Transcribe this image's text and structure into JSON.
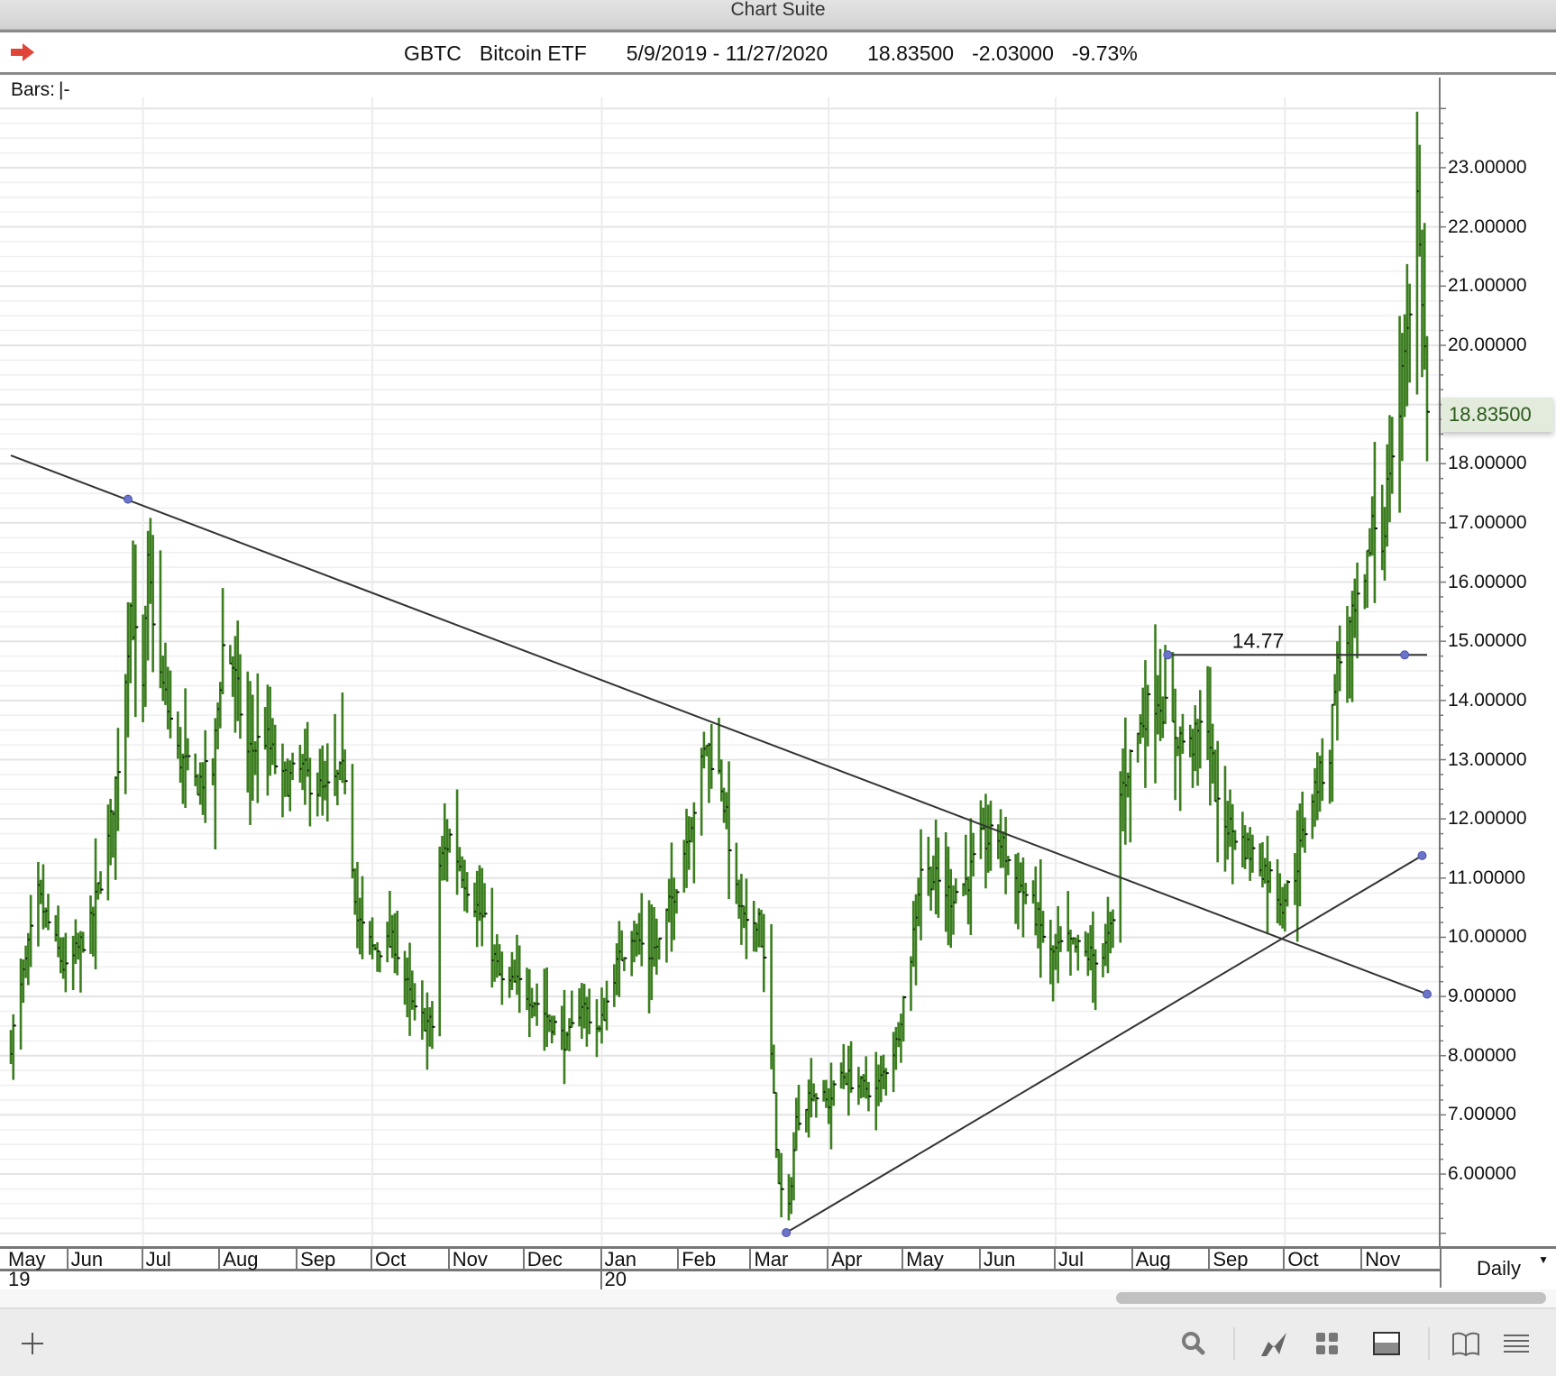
{
  "window": {
    "title": "Chart Suite"
  },
  "header": {
    "symbol": "GBTC",
    "name": "Bitcoin ETF",
    "range": "5/9/2019 - 11/27/2020",
    "last": "18.83500",
    "change": "-2.03000",
    "change_pct": "-9.73%",
    "nav_icon": "red-arrow-icon"
  },
  "bars_label": "Bars:",
  "bars_style": "|-",
  "interval": "Daily",
  "colors": {
    "bar": "#3b7d1f",
    "trendline": "#333333",
    "handle": "#6c74c9",
    "price_highlight": "#e2ebdc"
  },
  "toolbar": {
    "icons": [
      "plus-icon",
      "search-icon",
      "line-chart-icon",
      "grid-icon",
      "panel-icon",
      "book-icon",
      "menu-icon"
    ]
  },
  "chart_data": {
    "type": "ohlc",
    "title": "GBTC Bitcoin ETF",
    "start": "2019-05-09",
    "end": "2020-11-27",
    "ylim": [
      4.75,
      24
    ],
    "y_ticks": [
      "23.00000",
      "22.00000",
      "21.00000",
      "20.00000",
      "18.00000",
      "17.00000",
      "16.00000",
      "15.00000",
      "14.00000",
      "13.00000",
      "12.00000",
      "11.00000",
      "10.00000",
      "9.00000",
      "8.00000",
      "7.00000",
      "6.00000"
    ],
    "y_tick_values": [
      23,
      22,
      21,
      20,
      18,
      17,
      16,
      15,
      14,
      13,
      12,
      11,
      10,
      9,
      8,
      7,
      6
    ],
    "last_price": "18.83500",
    "months": [
      {
        "label": "May",
        "date": "2019-05-09"
      },
      {
        "label": "Jun",
        "date": "2019-06-01"
      },
      {
        "label": "Jul",
        "date": "2019-07-01"
      },
      {
        "label": "Aug",
        "date": "2019-08-01"
      },
      {
        "label": "Sep",
        "date": "2019-09-01"
      },
      {
        "label": "Oct",
        "date": "2019-10-01"
      },
      {
        "label": "Nov",
        "date": "2019-11-01"
      },
      {
        "label": "Dec",
        "date": "2019-12-01"
      },
      {
        "label": "Jan",
        "date": "2020-01-01"
      },
      {
        "label": "Feb",
        "date": "2020-02-01"
      },
      {
        "label": "Mar",
        "date": "2020-03-01"
      },
      {
        "label": "Apr",
        "date": "2020-04-01"
      },
      {
        "label": "May",
        "date": "2020-05-01"
      },
      {
        "label": "Jun",
        "date": "2020-06-01"
      },
      {
        "label": "Jul",
        "date": "2020-07-01"
      },
      {
        "label": "Aug",
        "date": "2020-08-01"
      },
      {
        "label": "Sep",
        "date": "2020-09-01"
      },
      {
        "label": "Oct",
        "date": "2020-10-01"
      },
      {
        "label": "Nov",
        "date": "2020-11-01"
      }
    ],
    "years": [
      {
        "label": "19",
        "date": "2019-05-09"
      },
      {
        "label": "20",
        "date": "2020-01-01"
      }
    ],
    "close_path": [
      [
        "2019-05-09",
        8.2
      ],
      [
        "2019-05-20",
        10.7
      ],
      [
        "2019-05-31",
        9.4
      ],
      [
        "2019-06-10",
        10.2
      ],
      [
        "2019-06-17",
        11.6
      ],
      [
        "2019-06-22",
        13.3
      ],
      [
        "2019-06-26",
        15.6
      ],
      [
        "2019-07-01",
        14.1
      ],
      [
        "2019-07-03",
        16.2
      ],
      [
        "2019-07-08",
        14.4
      ],
      [
        "2019-07-15",
        13.1
      ],
      [
        "2019-07-22",
        12.6
      ],
      [
        "2019-07-29",
        12.8
      ],
      [
        "2019-08-02",
        14.9
      ],
      [
        "2019-08-06",
        14.6
      ],
      [
        "2019-08-12",
        13.1
      ],
      [
        "2019-08-19",
        13.4
      ],
      [
        "2019-08-26",
        12.6
      ],
      [
        "2019-09-03",
        12.8
      ],
      [
        "2019-09-12",
        12.4
      ],
      [
        "2019-09-20",
        12.8
      ],
      [
        "2019-09-25",
        10.3
      ],
      [
        "2019-10-01",
        9.8
      ],
      [
        "2019-10-10",
        9.9
      ],
      [
        "2019-10-18",
        8.7
      ],
      [
        "2019-10-25",
        8.5
      ],
      [
        "2019-10-28",
        11.2
      ],
      [
        "2019-11-01",
        11.7
      ],
      [
        "2019-11-08",
        10.9
      ],
      [
        "2019-11-15",
        10.2
      ],
      [
        "2019-11-22",
        9.2
      ],
      [
        "2019-11-29",
        9.2
      ],
      [
        "2019-12-06",
        8.9
      ],
      [
        "2019-12-15",
        8.4
      ],
      [
        "2019-12-18",
        8.2
      ],
      [
        "2019-12-24",
        8.9
      ],
      [
        "2019-12-31",
        8.4
      ],
      [
        "2020-01-06",
        9.4
      ],
      [
        "2020-01-13",
        10.1
      ],
      [
        "2020-01-20",
        9.7
      ],
      [
        "2020-01-24",
        9.9
      ],
      [
        "2020-02-01",
        11.1
      ],
      [
        "2020-02-08",
        12.4
      ],
      [
        "2020-02-12",
        13.3
      ],
      [
        "2020-02-18",
        12.6
      ],
      [
        "2020-02-24",
        10.7
      ],
      [
        "2020-02-28",
        10.1
      ],
      [
        "2020-03-04",
        10.4
      ],
      [
        "2020-03-08",
        8.7
      ],
      [
        "2020-03-12",
        5.8
      ],
      [
        "2020-03-16",
        5.4
      ],
      [
        "2020-03-19",
        6.9
      ],
      [
        "2020-03-25",
        7.4
      ],
      [
        "2020-04-01",
        7.2
      ],
      [
        "2020-04-06",
        7.7
      ],
      [
        "2020-04-13",
        7.5
      ],
      [
        "2020-04-20",
        7.4
      ],
      [
        "2020-04-28",
        8.2
      ],
      [
        "2020-05-04",
        9.7
      ],
      [
        "2020-05-08",
        11.2
      ],
      [
        "2020-05-13",
        11.0
      ],
      [
        "2020-05-20",
        10.7
      ],
      [
        "2020-05-27",
        11.0
      ],
      [
        "2020-06-01",
        11.6
      ],
      [
        "2020-06-08",
        11.7
      ],
      [
        "2020-06-15",
        11.0
      ],
      [
        "2020-06-22",
        10.5
      ],
      [
        "2020-06-29",
        9.7
      ],
      [
        "2020-07-06",
        9.9
      ],
      [
        "2020-07-13",
        9.7
      ],
      [
        "2020-07-20",
        9.7
      ],
      [
        "2020-07-24",
        10.2
      ],
      [
        "2020-07-27",
        12.4
      ],
      [
        "2020-08-01",
        13.2
      ],
      [
        "2020-08-06",
        13.8
      ],
      [
        "2020-08-11",
        14.1
      ],
      [
        "2020-08-17",
        13.5
      ],
      [
        "2020-08-24",
        13.2
      ],
      [
        "2020-08-31",
        13.7
      ],
      [
        "2020-09-04",
        12.1
      ],
      [
        "2020-09-10",
        11.8
      ],
      [
        "2020-09-18",
        11.4
      ],
      [
        "2020-09-24",
        11.1
      ],
      [
        "2020-09-30",
        10.6
      ],
      [
        "2020-10-05",
        11.1
      ],
      [
        "2020-10-12",
        12.4
      ],
      [
        "2020-10-19",
        13.1
      ],
      [
        "2020-10-21",
        14.4
      ],
      [
        "2020-10-26",
        15.1
      ],
      [
        "2020-11-02",
        15.8
      ],
      [
        "2020-11-05",
        17.1
      ],
      [
        "2020-11-09",
        16.6
      ],
      [
        "2020-11-12",
        18.0
      ],
      [
        "2020-11-16",
        18.8
      ],
      [
        "2020-11-18",
        20.0
      ],
      [
        "2020-11-20",
        20.8
      ],
      [
        "2020-11-23",
        22.5
      ],
      [
        "2020-11-24",
        21.6
      ],
      [
        "2020-11-25",
        20.9
      ],
      [
        "2020-11-27",
        18.835
      ]
    ],
    "annotations": {
      "trendline_down": {
        "from": [
          "2019-05-09",
          18.14
        ],
        "handle": [
          "2019-06-25",
          17.4
        ],
        "to": [
          "2020-11-27",
          9.04
        ]
      },
      "trendline_up": {
        "from": [
          "2020-03-15",
          5.01
        ],
        "to": [
          "2020-11-25",
          11.38
        ]
      },
      "horizontal": {
        "label": "14.77",
        "value": 14.77,
        "from": "2020-08-15",
        "handle": "2020-11-18",
        "to": "2020-11-27"
      }
    }
  }
}
